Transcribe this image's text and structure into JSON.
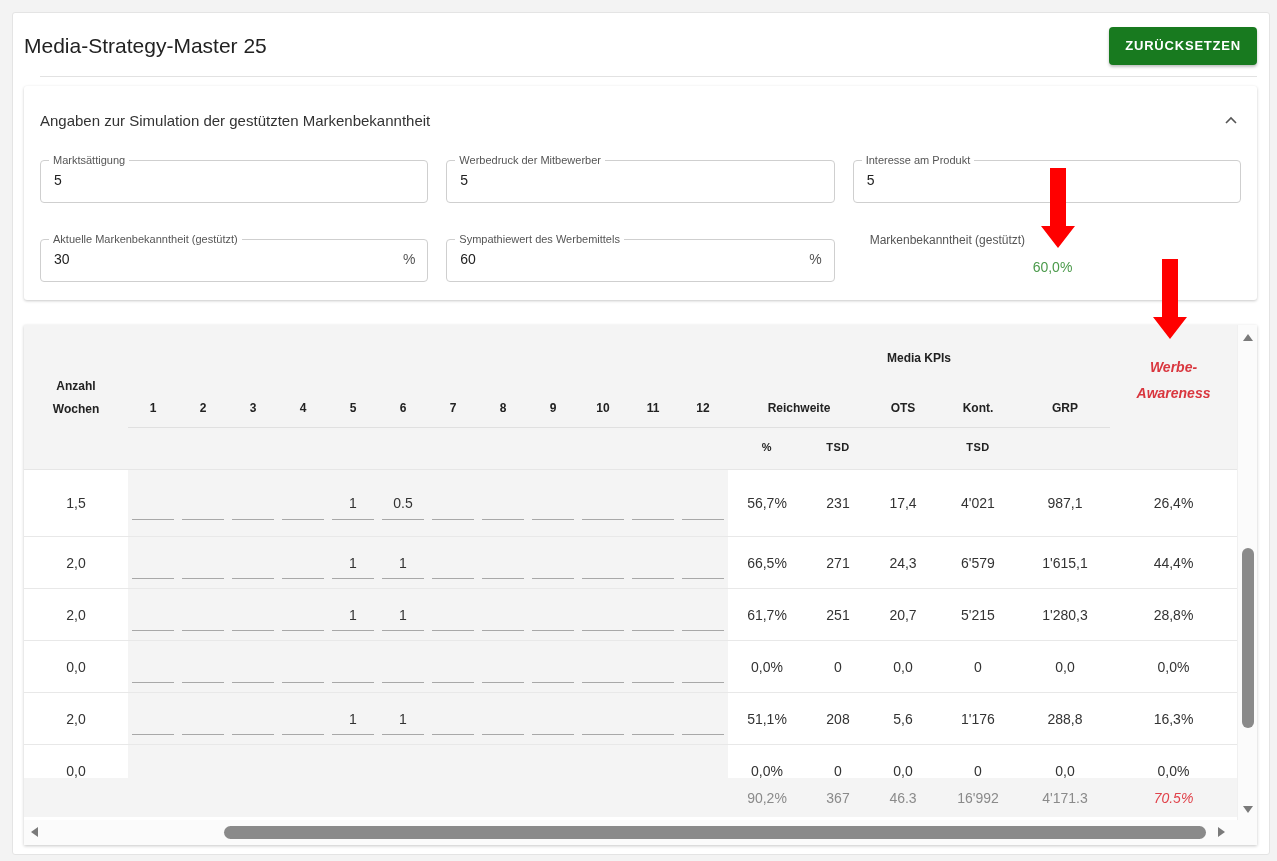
{
  "title": "Media-Strategy-Master 25",
  "reset_button": "ZURÜCKSETZEN",
  "panel": {
    "title": "Angaben zur Simulation der gestützten Markenbekanntheit",
    "expanded": true,
    "fields": [
      {
        "kind": "input",
        "label": "Marktsättigung",
        "value": "5"
      },
      {
        "kind": "input",
        "label": "Werbedruck der Mitbewerber",
        "value": "5"
      },
      {
        "kind": "input",
        "label": "Interesse am Produkt",
        "value": "5"
      },
      {
        "kind": "input",
        "label": "Aktuelle Markenbekanntheit (gestützt)",
        "value": "30",
        "unit": "%"
      },
      {
        "kind": "input",
        "label": "Sympathiewert des Werbemittels",
        "value": "60",
        "unit": "%"
      },
      {
        "kind": "output",
        "label": "Markenbekanntheit (gestützt)",
        "value": "60,0%"
      }
    ]
  },
  "annotations": [
    {
      "kind": "arrow",
      "color": "#ff0000"
    },
    {
      "kind": "arrow",
      "color": "#ff0000"
    }
  ],
  "table": {
    "weeks_label": "Anzahl Wochen",
    "week_numbers": [
      "1",
      "2",
      "3",
      "4",
      "5",
      "6",
      "7",
      "8",
      "9",
      "10",
      "11",
      "12"
    ],
    "group_label": "Media KPIs",
    "kpi_headers": [
      {
        "label": "Reichweite",
        "units": [
          "%",
          "TSD"
        ]
      },
      {
        "label": "OTS"
      },
      {
        "label": "Kont.",
        "units": [
          "TSD"
        ]
      },
      {
        "label": "GRP"
      }
    ],
    "awareness_label": "Werbe-Awareness",
    "rows": [
      {
        "weeks": "1,5",
        "plan": [
          {
            "empty": true
          },
          {
            "empty": true
          },
          {
            "empty": true
          },
          {
            "empty": true
          },
          {
            "value": "1"
          },
          {
            "value": "0.5"
          },
          {
            "empty": true
          },
          {
            "empty": true
          },
          {
            "empty": true
          },
          {
            "empty": true
          },
          {
            "empty": true
          },
          {
            "empty": true
          }
        ],
        "kpis": [
          "56,7%",
          "231",
          "17,4",
          "4'021",
          "987,1"
        ],
        "awareness": "26,4%"
      },
      {
        "weeks": "2,0",
        "plan": [
          {
            "empty": true
          },
          {
            "empty": true
          },
          {
            "empty": true
          },
          {
            "empty": true
          },
          {
            "value": "1"
          },
          {
            "value": "1"
          },
          {
            "empty": true
          },
          {
            "empty": true
          },
          {
            "empty": true
          },
          {
            "empty": true
          },
          {
            "empty": true
          },
          {
            "empty": true
          }
        ],
        "kpis": [
          "66,5%",
          "271",
          "24,3",
          "6'579",
          "1'615,1"
        ],
        "awareness": "44,4%"
      },
      {
        "weeks": "2,0",
        "plan": [
          {
            "empty": true
          },
          {
            "empty": true
          },
          {
            "empty": true
          },
          {
            "empty": true
          },
          {
            "value": "1"
          },
          {
            "value": "1"
          },
          {
            "empty": true
          },
          {
            "empty": true
          },
          {
            "empty": true
          },
          {
            "empty": true
          },
          {
            "empty": true
          },
          {
            "empty": true
          }
        ],
        "kpis": [
          "61,7%",
          "251",
          "20,7",
          "5'215",
          "1'280,3"
        ],
        "awareness": "28,8%"
      },
      {
        "weeks": "0,0",
        "plan": [
          {
            "empty": true
          },
          {
            "empty": true
          },
          {
            "empty": true
          },
          {
            "empty": true
          },
          {
            "empty": true
          },
          {
            "empty": true
          },
          {
            "empty": true
          },
          {
            "empty": true
          },
          {
            "empty": true
          },
          {
            "empty": true
          },
          {
            "empty": true
          },
          {
            "empty": true
          }
        ],
        "kpis": [
          "0,0%",
          "0",
          "0,0",
          "0",
          "0,0"
        ],
        "awareness": "0,0%"
      },
      {
        "weeks": "2,0",
        "plan": [
          {
            "empty": true
          },
          {
            "empty": true
          },
          {
            "empty": true
          },
          {
            "empty": true
          },
          {
            "value": "1"
          },
          {
            "value": "1"
          },
          {
            "empty": true
          },
          {
            "empty": true
          },
          {
            "empty": true
          },
          {
            "empty": true
          },
          {
            "empty": true
          },
          {
            "empty": true
          }
        ],
        "kpis": [
          "51,1%",
          "208",
          "5,6",
          "1'176",
          "288,8"
        ],
        "awareness": "16,3%"
      },
      {
        "weeks": "0,0",
        "plan": [
          {
            "empty": true
          },
          {
            "empty": true
          },
          {
            "empty": true
          },
          {
            "empty": true
          },
          {
            "empty": true
          },
          {
            "empty": true
          },
          {
            "empty": true
          },
          {
            "empty": true
          },
          {
            "empty": true
          },
          {
            "empty": true
          },
          {
            "empty": true
          },
          {
            "empty": true
          }
        ],
        "kpis": [
          "0,0%",
          "0",
          "0,0",
          "0",
          "0,0"
        ],
        "awareness": "0,0%"
      }
    ],
    "totals": {
      "kpis": [
        "90,2%",
        "367",
        "46.3",
        "16'992",
        "4'171.3"
      ],
      "awareness": "70.5%"
    }
  }
}
